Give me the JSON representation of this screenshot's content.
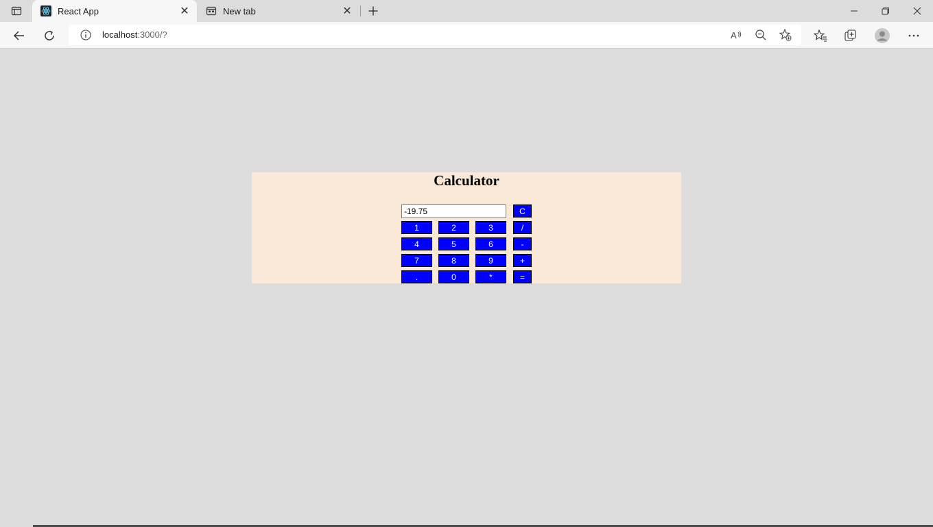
{
  "browser": {
    "tabs": [
      {
        "title": "React App",
        "favicon": "react-icon",
        "active": true
      },
      {
        "title": "New tab",
        "favicon": "newtab-icon",
        "active": false
      }
    ],
    "address": {
      "host": "localhost",
      "path": ":3000/?"
    }
  },
  "calculator": {
    "title": "Calculator",
    "display_value": "-19.75",
    "clear_label": "C",
    "rows": [
      {
        "digits": [
          "1",
          "2",
          "3"
        ],
        "op": "/"
      },
      {
        "digits": [
          "4",
          "5",
          "6"
        ],
        "op": "-"
      },
      {
        "digits": [
          "7",
          "8",
          "9"
        ],
        "op": "+"
      },
      {
        "digits": [
          ".",
          "0",
          "*"
        ],
        "op": "="
      }
    ]
  },
  "colors": {
    "page_bg": "#dcdcdc",
    "panel_bg": "#fae8d6",
    "key_bg": "#0000ff",
    "key_text": "#ffffff"
  }
}
